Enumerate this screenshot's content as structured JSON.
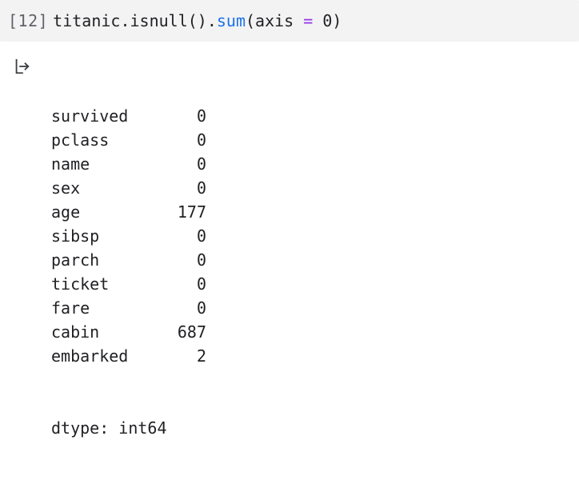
{
  "cell": {
    "execution_count_display": "[12]",
    "code": {
      "prefix": "titanic.isnull().",
      "method": "sum",
      "args_open": "(axis ",
      "equals": "=",
      "args_rest": " 0)"
    },
    "output": {
      "series": [
        {
          "label": "survived",
          "value": "0"
        },
        {
          "label": "pclass",
          "value": "0"
        },
        {
          "label": "name",
          "value": "0"
        },
        {
          "label": "sex",
          "value": "0"
        },
        {
          "label": "age",
          "value": "177"
        },
        {
          "label": "sibsp",
          "value": "0"
        },
        {
          "label": "parch",
          "value": "0"
        },
        {
          "label": "ticket",
          "value": "0"
        },
        {
          "label": "fare",
          "value": "0"
        },
        {
          "label": "cabin",
          "value": "687"
        },
        {
          "label": "embarked",
          "value": "2"
        }
      ],
      "dtype_line": "dtype: int64"
    }
  }
}
